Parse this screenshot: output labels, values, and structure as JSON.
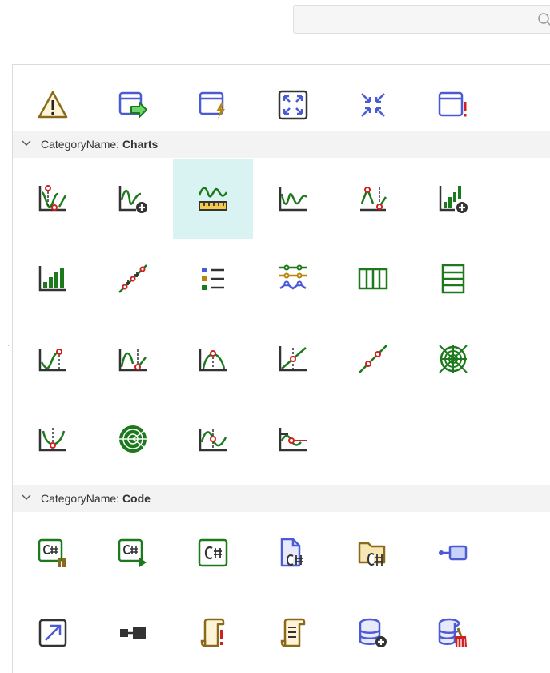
{
  "search": {
    "placeholder": "",
    "icon": "search-icon"
  },
  "colors": {
    "green": "#1c7a1c",
    "blue": "#4a5bd4",
    "brown": "#8a6a1a",
    "red": "#d02020",
    "selected": "#d9f2f2"
  },
  "categories": [
    {
      "prefix": "CategoryName: ",
      "name": "Charts"
    },
    {
      "prefix": "CategoryName: ",
      "name": "Code"
    }
  ],
  "rows": {
    "top": [
      "warning-icon",
      "window-go-icon",
      "window-lightning-icon",
      "expand-icon",
      "collapse-icon",
      "window-error-icon"
    ],
    "charts1": [
      "chart-min-max-icon",
      "chart-add-icon",
      "chart-ruler-icon",
      "chart-wave-icon",
      "chart-threshold-icon",
      "bar-chart-add-icon"
    ],
    "charts2": [
      "bar-chart-icon",
      "scatter-line-icon",
      "legend-list-icon",
      "multi-series-icon",
      "table-columns-icon",
      "table-rows-icon"
    ],
    "charts3": [
      "chart-peak-icon",
      "chart-bell-icon",
      "chart-arc-icon",
      "chart-axis-icon",
      "trend-line-icon",
      "radar-chart-icon"
    ],
    "charts4": [
      "chart-valley-icon",
      "polar-chart-icon",
      "chart-sine-point-icon",
      "chart-offset-icon"
    ],
    "code1": [
      "csharp-pause-icon",
      "csharp-run-icon",
      "csharp-icon",
      "csharp-file-icon",
      "csharp-folder-icon",
      "connector-icon"
    ],
    "code2": [
      "open-external-icon",
      "link-nodes-icon",
      "script-error-icon",
      "script-icon",
      "database-add-icon",
      "database-clear-icon"
    ]
  }
}
